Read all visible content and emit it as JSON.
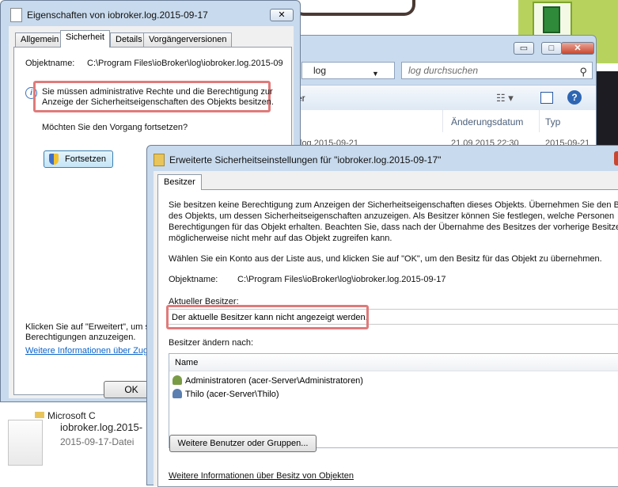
{
  "explorer": {
    "address": "log",
    "search_placeholder": "log durchsuchen",
    "toolbar_text": "er",
    "columns": {
      "date": "Änderungsdatum",
      "type": "Typ"
    },
    "row": {
      "name": "log.2015-09-21",
      "date": "21.09.2015 22:30",
      "type": "2015-09-21"
    },
    "buttons": {
      "minimize": "▭",
      "maximize": "□",
      "close": "✕"
    }
  },
  "properties": {
    "title": "Eigenschaften von iobroker.log.2015-09-17",
    "tabs": [
      "Allgemein",
      "Sicherheit",
      "Details",
      "Vorgängerversionen"
    ],
    "object_name_label": "Objektname:",
    "object_name_value": "C:\\Program Files\\ioBroker\\log\\iobroker.log.2015-09",
    "warning_line1": "Sie müssen administrative Rechte und die Berechtigung zur",
    "warning_line2": "Anzeige der Sicherheitseigenschaften des Objekts besitzen.",
    "question": "Möchten Sie den Vorgang fortsetzen?",
    "continue_button": "Fortsetzen",
    "advanced_hint_line1": "Klicken Sie auf \"Erweitert\", um s",
    "advanced_hint_line2": "Berechtigungen anzuzeigen.",
    "more_info_link": "Weitere Informationen über Zugr",
    "ok_button": "OK",
    "close_button": "✕"
  },
  "file_preview": {
    "folder_label": "Microsoft C",
    "name": "iobroker.log.2015-",
    "type": "2015-09-17-Datei"
  },
  "advanced": {
    "title": "Erweiterte Sicherheitseinstellungen für \"iobroker.log.2015-09-17\"",
    "tab": "Besitzer",
    "info_lines": [
      "Sie besitzen keine Berechtigung zum Anzeigen der Sicherheitseigenschaften dieses Objekts. Übernehmen Sie den Besitz",
      "des Objekts, um dessen Sicherheitseigenschaften anzuzeigen. Als Besitzer können Sie festlegen, welche Personen",
      "Berechtigungen für das Objekt erhalten. Beachten Sie, dass nach der Übernahme des Besitzes der vorherige Besitzer",
      "möglicherweise nicht mehr auf das Objekt zugreifen kann."
    ],
    "choose_text": "Wählen Sie ein Konto aus der Liste aus, und klicken Sie auf \"OK\", um den Besitz für das Objekt zu übernehmen.",
    "object_name_label": "Objektname:",
    "object_name_value": "C:\\Program Files\\ioBroker\\log\\iobroker.log.2015-09-17",
    "current_owner_label": "Aktueller Besitzer:",
    "current_owner_value": "Der aktuelle Besitzer kann nicht angezeigt werden.",
    "change_owner_label": "Besitzer ändern nach:",
    "list_header": "Name",
    "owners": [
      "Administratoren (acer-Server\\Administratoren)",
      "Thilo (acer-Server\\Thilo)"
    ],
    "more_users_button": "Weitere Benutzer oder Gruppen...",
    "ownership_link": "Weitere Informationen über Besitz von Objekten"
  },
  "colors": {
    "highlight_border": "#e07a7a",
    "link": "#0a63c9",
    "window_frame": "#c8daed"
  }
}
